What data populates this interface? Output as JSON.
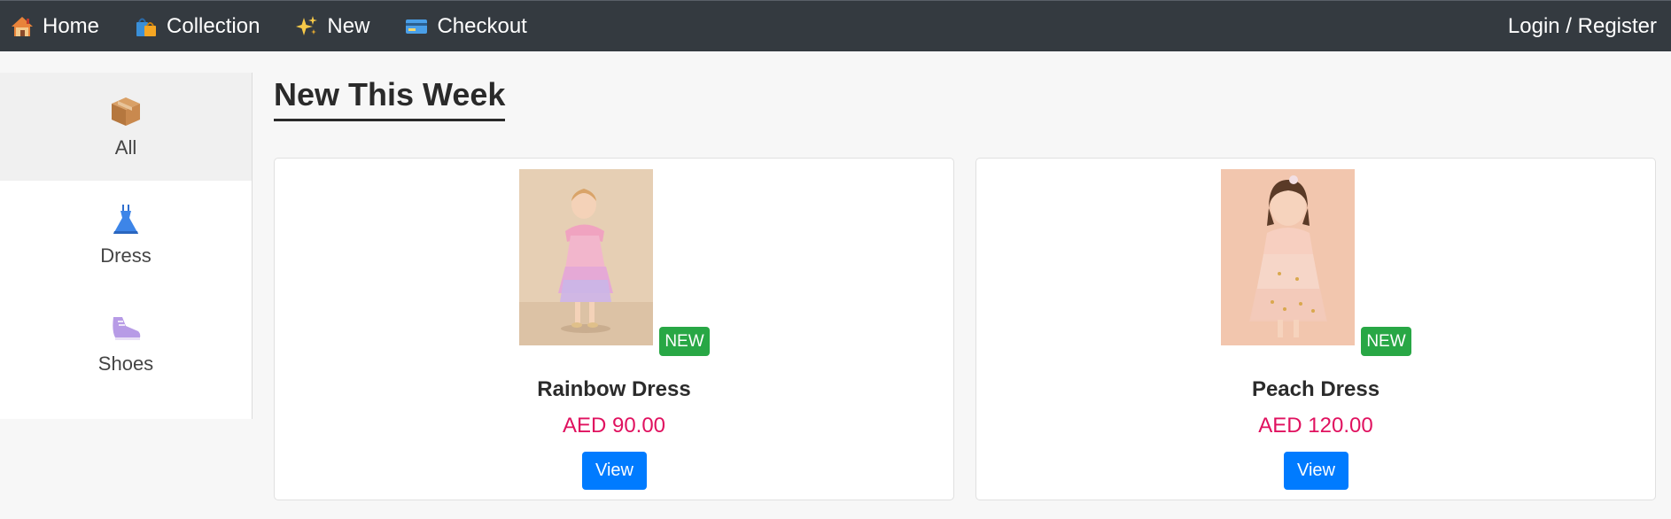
{
  "navbar": {
    "links": [
      {
        "label": "Home",
        "icon": "house-icon"
      },
      {
        "label": "Collection",
        "icon": "shopping-bags-icon"
      },
      {
        "label": "New",
        "icon": "sparkles-icon"
      },
      {
        "label": "Checkout",
        "icon": "credit-card-icon"
      }
    ],
    "auth_label": "Login / Register",
    "background": "#343a40"
  },
  "sidebar": {
    "items": [
      {
        "label": "All",
        "icon": "package-icon",
        "active": true
      },
      {
        "label": "Dress",
        "icon": "dress-icon",
        "active": false
      },
      {
        "label": "Shoes",
        "icon": "sneaker-icon",
        "active": false
      }
    ]
  },
  "main": {
    "title": "New This Week",
    "products": [
      {
        "name": "Rainbow Dress",
        "price": "AED 90.00",
        "badge": "NEW",
        "button": "View"
      },
      {
        "name": "Peach Dress",
        "price": "AED 120.00",
        "badge": "NEW",
        "button": "View"
      }
    ]
  },
  "colors": {
    "badge": "#28a745",
    "price": "#e0115f",
    "button": "#007bff"
  }
}
